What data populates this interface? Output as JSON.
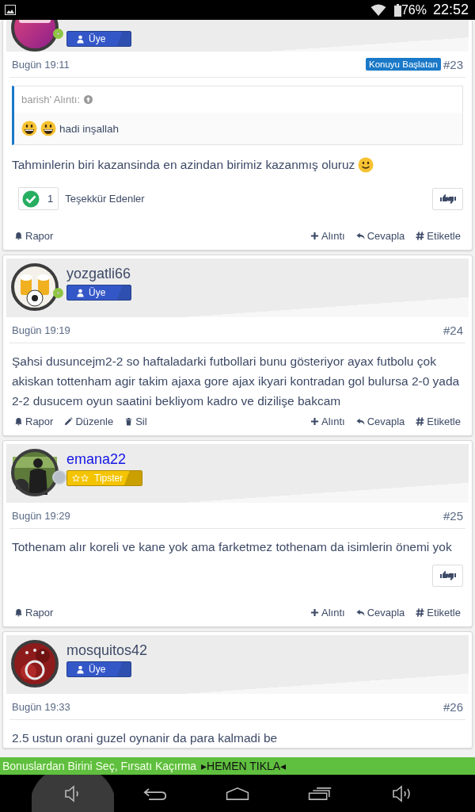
{
  "status_bar": {
    "battery": "76%",
    "time": "22:52"
  },
  "posts": [
    {
      "avatar": {
        "kind": "picture"
      },
      "online": true,
      "rank": {
        "kind": "member",
        "label": "Üye"
      },
      "date": "Bugün 19:11",
      "starter_badge": "Konuyu Başlatan",
      "number": "#23",
      "quote": {
        "author": "barish' Alıntı:",
        "emojis": [
          {
            "kind": "grin"
          },
          {
            "kind": "grin"
          }
        ],
        "text": "hadi inşallah"
      },
      "message": {
        "text": "Tahminlerin biri kazansinda en azindan birimiz kazanmış oluruz",
        "emoji_after": {
          "kind": "smile"
        }
      },
      "thanks": {
        "count": "1",
        "label": "Teşekkür Edenler"
      },
      "like_button": true,
      "actions_left": [
        {
          "kind": "report",
          "label": "Rapor"
        }
      ],
      "actions_right": [
        {
          "kind": "quote",
          "label": "Alıntı"
        },
        {
          "kind": "reply",
          "label": "Cevapla"
        },
        {
          "kind": "tag",
          "label": "Etiketle"
        }
      ]
    },
    {
      "avatar": {
        "kind": "picture"
      },
      "author": {
        "name": "yozgatli66",
        "color": "#3d4a66"
      },
      "online": true,
      "rank": {
        "kind": "member",
        "label": "Üye"
      },
      "date": "Bugün 19:19",
      "number": "#24",
      "message": {
        "text": "Şahsi dusuncejm2-2 so haftaladarki futbollari bunu gösteriyor ayax futbolu çok akiskan tottenham agir takim ajaxa gore ajax ikyari kontradan gol bulursa 2-0 yada 2-2 dusucem oyun saatini bekliyom kadro ve dizilişe bakcam"
      },
      "actions_left": [
        {
          "kind": "report",
          "label": "Rapor"
        },
        {
          "kind": "edit",
          "label": "Düzenle"
        },
        {
          "kind": "delete",
          "label": "Sil"
        }
      ],
      "actions_right": [
        {
          "kind": "quote",
          "label": "Alıntı"
        },
        {
          "kind": "reply",
          "label": "Cevapla"
        },
        {
          "kind": "tag",
          "label": "Etiketle"
        }
      ]
    },
    {
      "avatar": {
        "kind": "picture"
      },
      "author": {
        "name": "emana22",
        "color": "#1414e6"
      },
      "online": false,
      "rank": {
        "kind": "tipster",
        "label": "Tipster"
      },
      "date": "Bugün 19:29",
      "number": "#25",
      "message": {
        "text": "Tothenam alır koreli ve kane yok ama farketmez tothenam da isimlerin önemi yok"
      },
      "like_button": true,
      "actions_left": [
        {
          "kind": "report",
          "label": "Rapor"
        }
      ],
      "actions_right": [
        {
          "kind": "quote",
          "label": "Alıntı"
        },
        {
          "kind": "reply",
          "label": "Cevapla"
        },
        {
          "kind": "tag",
          "label": "Etiketle"
        }
      ]
    },
    {
      "avatar": {
        "kind": "picture"
      },
      "author": {
        "name": "mosquitos42",
        "color": "#3d4a66"
      },
      "rank": {
        "kind": "member",
        "label": "Üye"
      },
      "date": "Bugün 19:33",
      "number": "#26",
      "message": {
        "text": "2.5 ustun orani guzel oynanir da para kalmadi be"
      }
    }
  ],
  "banner": {
    "text": "Bonuslardan Birini Seç, Fırsatı Kaçırma",
    "link": "▸HEMEN TIKLA◂"
  },
  "nav_bar": {
    "buttons": [
      {
        "kind": "volume_down",
        "pressed": true
      },
      {
        "kind": "back",
        "pressed": false
      },
      {
        "kind": "home",
        "pressed": false
      },
      {
        "kind": "recents",
        "pressed": false
      },
      {
        "kind": "volume_up",
        "pressed": false
      }
    ]
  }
}
